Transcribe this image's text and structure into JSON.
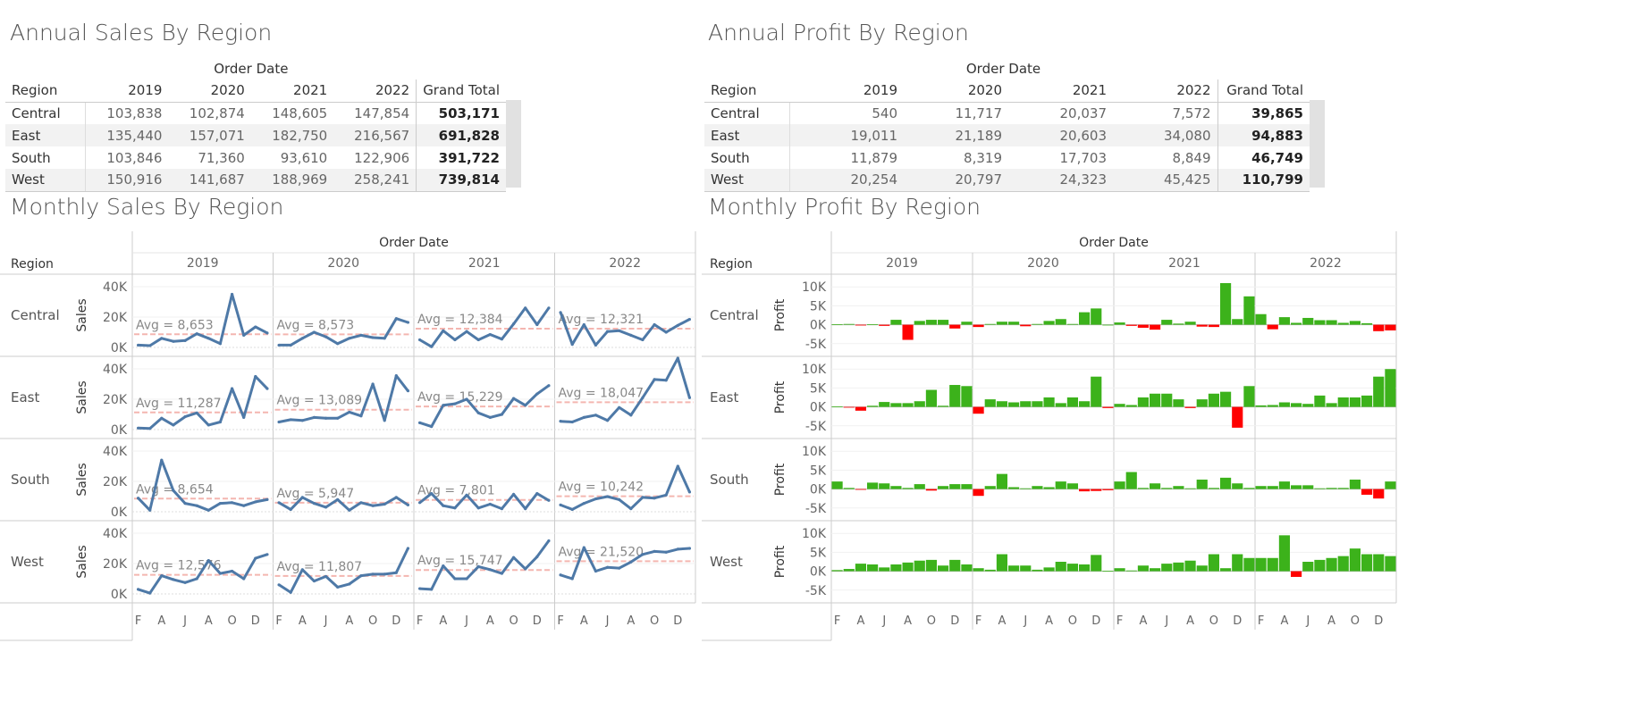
{
  "titles": {
    "annual_sales": "Annual Sales By Region",
    "annual_profit": "Annual Profit By Region",
    "monthly_sales": "Monthly Sales By Region",
    "monthly_profit": "Monthly Profit By Region"
  },
  "labels": {
    "order_date": "Order Date",
    "region": "Region",
    "grand_total": "Grand Total",
    "sales_axis": "Sales",
    "profit_axis": "Profit"
  },
  "years": [
    "2019",
    "2020",
    "2021",
    "2022"
  ],
  "month_ticks": [
    "F",
    "A",
    "J",
    "A",
    "O",
    "D"
  ],
  "regions": [
    "Central",
    "East",
    "South",
    "West"
  ],
  "sales_ticks": [
    "40K",
    "20K",
    "0K"
  ],
  "profit_ticks": [
    "10K",
    "5K",
    "0K",
    "-5K"
  ],
  "colors": {
    "line": "#4e79a7",
    "positive": "#3cb21b",
    "negative": "#ff0000",
    "avg_line": "#f4b6b0",
    "grid": "#e6e6e6",
    "divider": "#cccccc"
  },
  "annual_sales_table": {
    "rows": [
      {
        "region": "Central",
        "values": [
          "103,838",
          "102,874",
          "148,605",
          "147,854"
        ],
        "total": "503,171"
      },
      {
        "region": "East",
        "values": [
          "135,440",
          "157,071",
          "182,750",
          "216,567"
        ],
        "total": "691,828"
      },
      {
        "region": "South",
        "values": [
          "103,846",
          "71,360",
          "93,610",
          "122,906"
        ],
        "total": "391,722"
      },
      {
        "region": "West",
        "values": [
          "150,916",
          "141,687",
          "188,969",
          "258,241"
        ],
        "total": "739,814"
      }
    ]
  },
  "annual_profit_table": {
    "rows": [
      {
        "region": "Central",
        "values": [
          "540",
          "11,717",
          "20,037",
          "7,572"
        ],
        "total": "39,865"
      },
      {
        "region": "East",
        "values": [
          "19,011",
          "21,189",
          "20,603",
          "34,080"
        ],
        "total": "94,883"
      },
      {
        "region": "South",
        "values": [
          "11,879",
          "8,319",
          "17,703",
          "8,849"
        ],
        "total": "46,749"
      },
      {
        "region": "West",
        "values": [
          "20,254",
          "20,797",
          "24,323",
          "45,425"
        ],
        "total": "110,799"
      }
    ]
  },
  "chart_data": [
    {
      "type": "line",
      "title": "Monthly Sales By Region",
      "xlabel": "Order Date",
      "ylabel": "Sales",
      "ylim": [
        0,
        40000
      ],
      "panels": [
        {
          "region": "Central",
          "averages": [
            "Avg = 8,653",
            "Avg = 8,573",
            "Avg = 12,384",
            "Avg = 12,321"
          ],
          "avg_values": [
            8653,
            8573,
            12384,
            12321
          ],
          "values": [
            [
              1500,
              1200,
              6000,
              4000,
              4500,
              9000,
              6000,
              2500,
              35000,
              8000,
              13500,
              9500
            ],
            [
              1500,
              1500,
              6000,
              10000,
              7000,
              2500,
              6000,
              8000,
              6500,
              6000,
              19000,
              16500
            ],
            [
              5000,
              500,
              11000,
              5000,
              10500,
              5000,
              8500,
              5500,
              15500,
              26000,
              15000,
              26000
            ],
            [
              23000,
              2000,
              15000,
              1500,
              10500,
              11000,
              8000,
              5000,
              15000,
              10000,
              14500,
              18500
            ]
          ]
        },
        {
          "region": "East",
          "averages": [
            "Avg = 11,287",
            "Avg = 13,089",
            "Avg = 15,229",
            "Avg = 18,047"
          ],
          "avg_values": [
            11287,
            13089,
            15229,
            18047
          ],
          "values": [
            [
              1000,
              700,
              7500,
              3000,
              8500,
              11000,
              3000,
              5000,
              27000,
              8000,
              35000,
              27000
            ],
            [
              5000,
              6500,
              6000,
              8000,
              7500,
              7500,
              11500,
              9000,
              30000,
              6000,
              35500,
              25500
            ],
            [
              4500,
              2000,
              16000,
              17000,
              20000,
              11000,
              8000,
              10000,
              20500,
              16000,
              23500,
              29000
            ],
            [
              5500,
              5000,
              8000,
              9500,
              6000,
              14500,
              9500,
              21000,
              33000,
              32500,
              47000,
              21000
            ]
          ]
        },
        {
          "region": "South",
          "averages": [
            "Avg = 8,654",
            "Avg = 5,947",
            "Avg = 7,801",
            "Avg = 10,242"
          ],
          "avg_values": [
            8654,
            5947,
            7801,
            10242
          ],
          "values": [
            [
              9000,
              1000,
              34000,
              14000,
              5500,
              4000,
              1000,
              5500,
              6000,
              4000,
              6500,
              8000
            ],
            [
              6000,
              1500,
              9500,
              5500,
              3000,
              8000,
              1000,
              6000,
              4000,
              5000,
              9500,
              4500
            ],
            [
              6000,
              12000,
              4000,
              2500,
              11000,
              2500,
              5000,
              2000,
              11500,
              2000,
              12000,
              7500
            ],
            [
              4500,
              1500,
              5500,
              8500,
              10000,
              8000,
              2000,
              9500,
              9000,
              11000,
              30000,
              13000
            ]
          ]
        },
        {
          "region": "West",
          "averages": [
            "Avg = 12,576",
            "Avg = 11,807",
            "Avg = 15,747",
            "Avg = 21,520"
          ],
          "avg_values": [
            12576,
            11807,
            15747,
            21520
          ],
          "values": [
            [
              3000,
              500,
              12000,
              9500,
              7500,
              10000,
              22000,
              13500,
              15000,
              10000,
              23500,
              26000
            ],
            [
              6000,
              1000,
              16000,
              8500,
              11500,
              4500,
              6500,
              12000,
              13000,
              13000,
              14000,
              30000
            ],
            [
              3500,
              3000,
              18500,
              10000,
              10000,
              18000,
              16000,
              13500,
              24000,
              16500,
              24500,
              35000
            ],
            [
              12500,
              10000,
              30500,
              15000,
              17500,
              17000,
              21000,
              26000,
              28000,
              27500,
              29500,
              30000
            ]
          ]
        }
      ]
    },
    {
      "type": "bar",
      "title": "Monthly Profit By Region",
      "xlabel": "Order Date",
      "ylabel": "Profit",
      "ylim": [
        -6000,
        11000
      ],
      "panels": [
        {
          "region": "Central",
          "values": [
            [
              100,
              200,
              -200,
              100,
              -300,
              1300,
              -4000,
              1000,
              1300,
              1300,
              -1000,
              800
            ],
            [
              -600,
              200,
              800,
              800,
              -400,
              200,
              1000,
              1500,
              200,
              3300,
              4300,
              0
            ],
            [
              600,
              -300,
              -800,
              -1300,
              1300,
              300,
              800,
              -500,
              -600,
              11000,
              1500,
              7500
            ],
            [
              2800,
              -1200,
              2000,
              500,
              1800,
              1200,
              1200,
              500,
              1000,
              400,
              -1700,
              -1500
            ]
          ]
        },
        {
          "region": "East",
          "values": [
            [
              100,
              -100,
              -1000,
              300,
              1300,
              1000,
              1000,
              1500,
              4500,
              300,
              5800,
              5500
            ],
            [
              -1800,
              2000,
              1500,
              1200,
              1500,
              1500,
              2500,
              1000,
              2500,
              1500,
              8000,
              -300
            ],
            [
              800,
              500,
              2500,
              3500,
              3500,
              2000,
              -300,
              2000,
              3500,
              4000,
              -5500,
              5500
            ],
            [
              400,
              500,
              1200,
              1000,
              800,
              3000,
              1000,
              2500,
              2500,
              3000,
              8000,
              10000
            ]
          ]
        },
        {
          "region": "South",
          "values": [
            [
              2000,
              300,
              -100,
              1700,
              1500,
              800,
              300,
              1300,
              -400,
              800,
              1300,
              1300
            ],
            [
              -1800,
              800,
              4000,
              500,
              200,
              800,
              500,
              2000,
              1500,
              -600,
              -500,
              -300
            ],
            [
              2000,
              4500,
              300,
              1500,
              300,
              800,
              200,
              2500,
              300,
              3000,
              1500,
              300
            ],
            [
              800,
              800,
              2000,
              1000,
              1000,
              200,
              300,
              300,
              2500,
              -1500,
              -2500,
              2000
            ]
          ]
        },
        {
          "region": "West",
          "values": [
            [
              300,
              600,
              2000,
              1800,
              1000,
              1800,
              2300,
              2800,
              3000,
              1500,
              3000,
              1800
            ],
            [
              800,
              400,
              4500,
              1500,
              1500,
              400,
              1000,
              2500,
              2000,
              1800,
              4300,
              100
            ],
            [
              800,
              200,
              1500,
              800,
              2000,
              2300,
              2800,
              1500,
              4500,
              800,
              4500,
              3500
            ],
            [
              3500,
              3500,
              9500,
              -1500,
              2500,
              3000,
              3500,
              4000,
              6000,
              4500,
              4500,
              4000
            ]
          ]
        }
      ]
    }
  ]
}
